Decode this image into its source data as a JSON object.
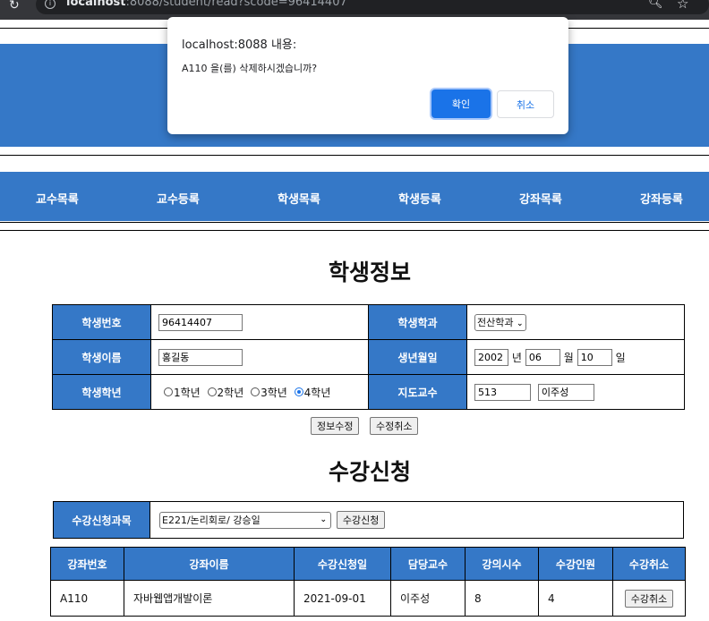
{
  "browser": {
    "url_host": "localhost",
    "url_rest": ":8088/student/read?scode=96414407",
    "icons": [
      "reload-icon",
      "info-icon",
      "zoom-icon",
      "bookmark-star-icon"
    ]
  },
  "nav": {
    "items": [
      "교수목록",
      "교수등록",
      "학생목록",
      "학생등록",
      "강좌목록",
      "강좌등록"
    ]
  },
  "student": {
    "title": "학생정보",
    "labels": {
      "id": "학생번호",
      "dept": "학생학과",
      "name": "학생이름",
      "birth": "생년월일",
      "year": "학생학년",
      "advisor": "지도교수"
    },
    "id_value": "96414407",
    "dept_value": "전산학과",
    "name_value": "홍길동",
    "birth": {
      "year": "2002",
      "year_unit": "년",
      "month": "06",
      "month_unit": "월",
      "day": "10",
      "day_unit": "일"
    },
    "grade_options": [
      "1학년",
      "2학년",
      "3학년",
      "4학년"
    ],
    "grade_selected": "4학년",
    "advisor_code": "513",
    "advisor_name": "이주성",
    "update_button": "정보수정",
    "cancel_button": "수정취소"
  },
  "enroll": {
    "title": "수강신청",
    "label": "수강신청과목",
    "selected_course": "E221/논리회로/ 강승일",
    "enroll_button": "수강신청"
  },
  "courses": {
    "headers": [
      "강좌번호",
      "강좌이름",
      "수강신청일",
      "담당교수",
      "강의시수",
      "수강인원",
      "수강취소"
    ],
    "rows": [
      {
        "code": "A110",
        "name": "자바웹앱개발이론",
        "date": "2021-09-01",
        "professor": "이주성",
        "hours": "8",
        "count": "4",
        "cancel_label": "수강취소"
      }
    ]
  },
  "dialog": {
    "title": "localhost:8088 내용:",
    "message": "A110 을(를) 삭제하시겠습니까?",
    "ok_label": "확인",
    "cancel_label": "취소"
  },
  "colors": {
    "brand_blue": "#3578c7",
    "dialog_ok": "#1a73e8"
  }
}
